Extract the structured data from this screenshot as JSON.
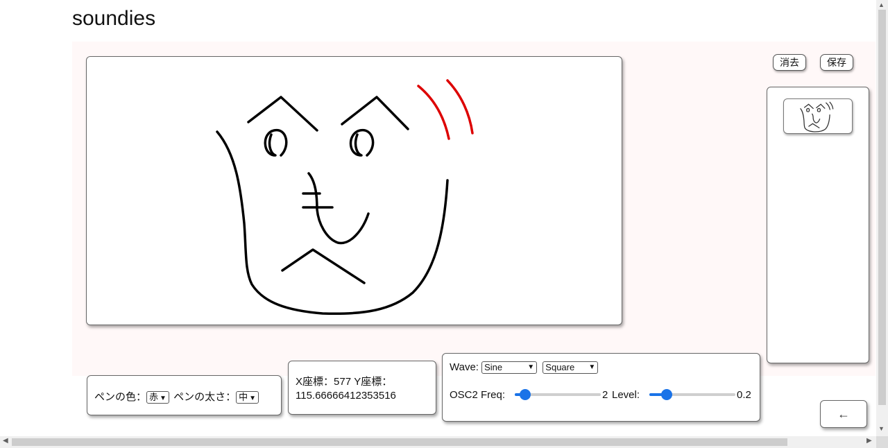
{
  "app": {
    "title": "soundies"
  },
  "toolbar": {
    "clear_label": "消去",
    "save_label": "保存"
  },
  "pen": {
    "color_label": "ペンの色：",
    "color_value": "赤",
    "size_label": "ペンの太さ：",
    "size_value": "中"
  },
  "coords": {
    "line1": "X座標：577 Y座標：",
    "line2": "115.66666412353516"
  },
  "synth": {
    "wave_label": "Wave:",
    "wave1": "Sine",
    "wave2": "Square",
    "freq_label": "OSC2 Freq:",
    "freq_value": "2",
    "freq_fraction": 0.12,
    "level_label": "Level:",
    "level_value": "0.2",
    "level_fraction": 0.2,
    "accent_color": "#1a73e8"
  },
  "nav": {
    "back_label": "←"
  },
  "scrollbars": {
    "left_arrow": "◀",
    "right_arrow": "▶",
    "up_arrow": "▲",
    "down_arrow": "▼"
  },
  "drawing": {
    "stroke_black": "#000000",
    "stroke_red": "#dd0000"
  }
}
